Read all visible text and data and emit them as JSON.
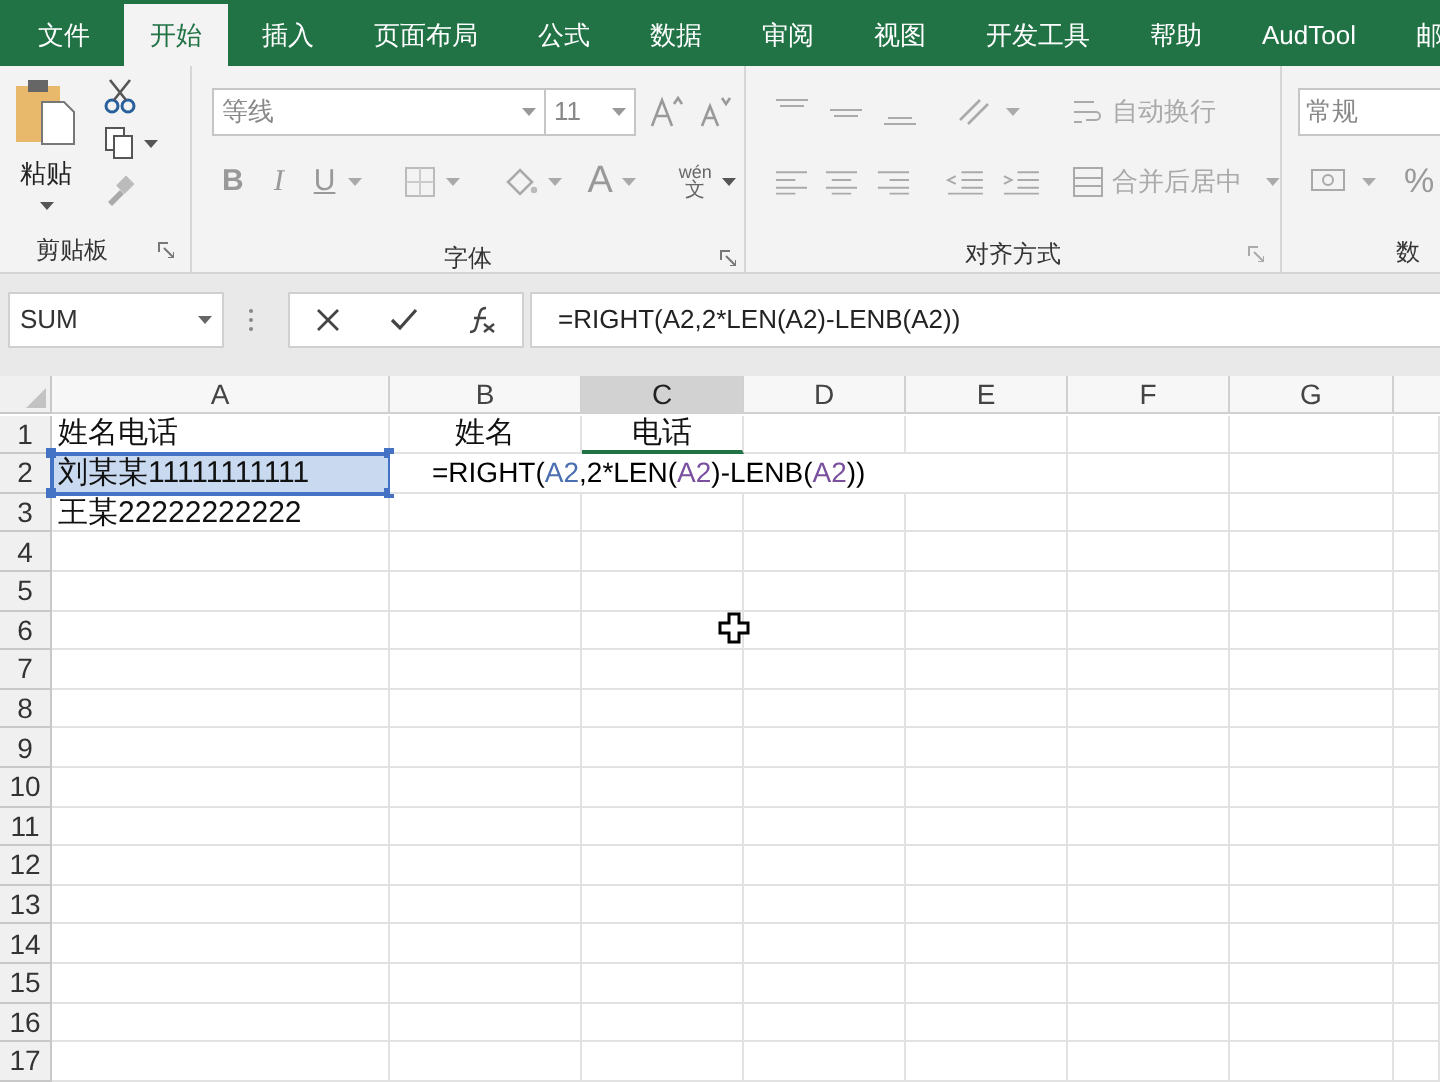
{
  "tabs": [
    {
      "label": "文件",
      "selected": false
    },
    {
      "label": "开始",
      "selected": true
    },
    {
      "label": "插入",
      "selected": false
    },
    {
      "label": "页面布局",
      "selected": false
    },
    {
      "label": "公式",
      "selected": false
    },
    {
      "label": "数据",
      "selected": false
    },
    {
      "label": "审阅",
      "selected": false
    },
    {
      "label": "视图",
      "selected": false
    },
    {
      "label": "开发工具",
      "selected": false
    },
    {
      "label": "帮助",
      "selected": false
    },
    {
      "label": "AudTool",
      "selected": false
    },
    {
      "label": "邮",
      "selected": false
    }
  ],
  "ribbon": {
    "clipboard": {
      "paste_label": "粘贴",
      "group_label": "剪贴板"
    },
    "font": {
      "font_name": "等线",
      "font_size": "11",
      "bold": "B",
      "italic": "I",
      "underline": "U",
      "font_color": "A",
      "phonetic_top": "wén",
      "phonetic_bottom": "文",
      "group_label": "字体"
    },
    "alignment": {
      "wrap_label": "自动换行",
      "merge_label": "合并后居中",
      "group_label": "对齐方式"
    },
    "number": {
      "format": "常规",
      "percent": "%",
      "group_label": "数"
    }
  },
  "formula_bar": {
    "name_box": "SUM",
    "formula": "=RIGHT(A2,2*LEN(A2)-LENB(A2))"
  },
  "sheet": {
    "columns": [
      {
        "label": "A",
        "selected": false
      },
      {
        "label": "B",
        "selected": false
      },
      {
        "label": "C",
        "selected": true
      },
      {
        "label": "D",
        "selected": false
      },
      {
        "label": "E",
        "selected": false
      },
      {
        "label": "F",
        "selected": false
      },
      {
        "label": "G",
        "selected": false
      }
    ],
    "rows": [
      {
        "label": "1",
        "cells": [
          {
            "text": "姓名电话"
          },
          {
            "text": "姓名"
          },
          {
            "text": "电话",
            "bottom_border": true
          }
        ]
      },
      {
        "label": "2",
        "cells": [
          {
            "text": "刘某某11111111111",
            "highlighted": true
          },
          {
            "kind": "editing",
            "segments": [
              {
                "text": "=RIGHT(",
                "color": "#000000"
              },
              {
                "text": "A2",
                "color": "#4a6fb0"
              },
              {
                "text": ",2*LEN(",
                "color": "#000000"
              },
              {
                "text": "A2",
                "color": "#7a4f9e"
              },
              {
                "text": ")-LENB(",
                "color": "#000000"
              },
              {
                "text": "A2",
                "color": "#7a4f9e"
              },
              {
                "text": "))",
                "color": "#000000"
              }
            ]
          }
        ]
      },
      {
        "label": "3",
        "cells": [
          {
            "text": "王某22222222222"
          }
        ]
      },
      {
        "label": "4"
      },
      {
        "label": "5"
      },
      {
        "label": "6"
      },
      {
        "label": "7"
      },
      {
        "label": "8"
      },
      {
        "label": "9"
      },
      {
        "label": "10"
      },
      {
        "label": "11"
      },
      {
        "label": "12"
      },
      {
        "label": "13"
      },
      {
        "label": "14"
      },
      {
        "label": "15"
      },
      {
        "label": "16"
      },
      {
        "label": "17"
      }
    ]
  }
}
